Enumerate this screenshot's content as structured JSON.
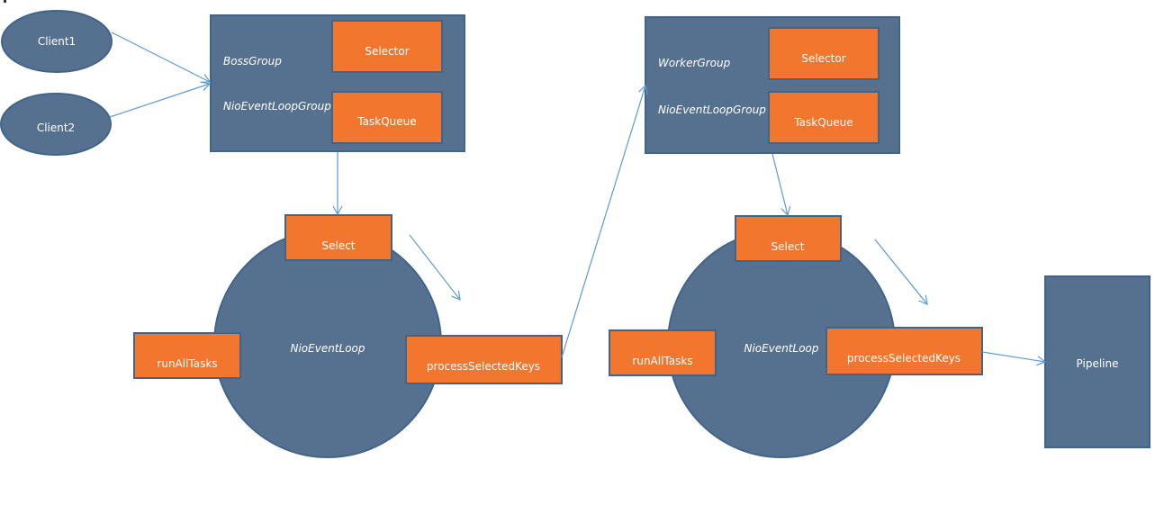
{
  "clients": [
    {
      "label": "Client1"
    },
    {
      "label": "Client2"
    }
  ],
  "boss_group": {
    "title": "BossGroup",
    "subtitle": "NioEventLoopGroup",
    "selector": "Selector",
    "task_queue": "TaskQueue"
  },
  "worker_group": {
    "title": "WorkerGroup",
    "subtitle": "NioEventLoopGroup",
    "selector": "Selector",
    "task_queue": "TaskQueue"
  },
  "boss_loop": {
    "label": "NioEventLoop",
    "select": "Select",
    "run_all_tasks": "runAllTasks",
    "process_selected_keys": "processSelectedKeys"
  },
  "worker_loop": {
    "label": "NioEventLoop",
    "select": "Select",
    "run_all_tasks": "runAllTasks",
    "process_selected_keys": "processSelectedKeys"
  },
  "pipeline": {
    "label": "Pipeline"
  },
  "colors": {
    "node_blue": "#56718f",
    "node_orange": "#f2762e",
    "arrow": "#5b9bd5"
  }
}
